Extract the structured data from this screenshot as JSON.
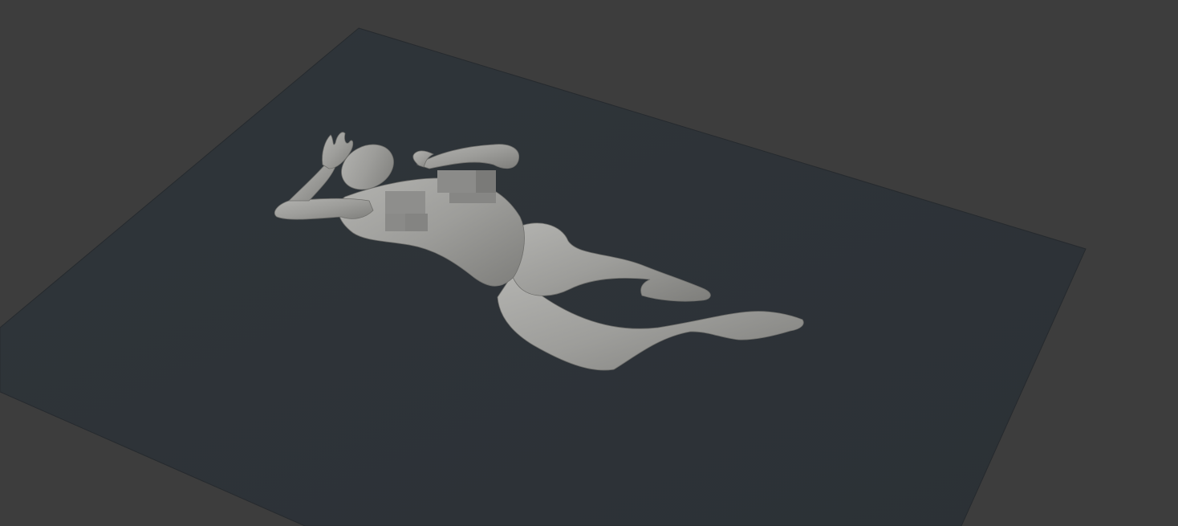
{
  "viewport": {
    "background_color": "#3d3d3d",
    "ground_plane_color": "#2e3338",
    "model_color": "#9a9a97",
    "censor_color": "#8a8a88"
  },
  "scene": {
    "objects": [
      {
        "name": "ground-plane"
      },
      {
        "name": "mesh-body"
      }
    ]
  }
}
